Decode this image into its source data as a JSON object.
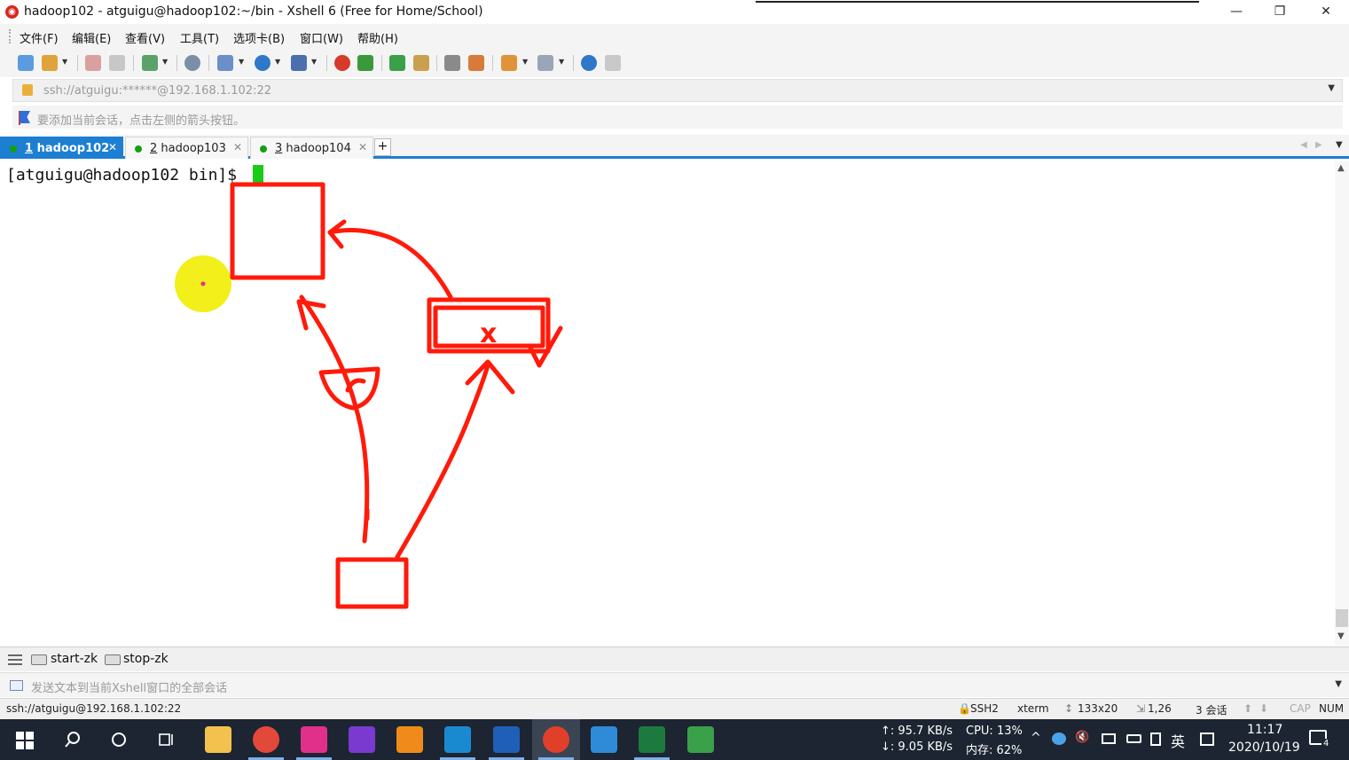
{
  "window": {
    "title": "hadoop102 - atguigu@hadoop102:~/bin - Xshell 6 (Free for Home/School)",
    "controls": {
      "minimize": "—",
      "restore": "❐",
      "close": "✕"
    }
  },
  "menu": [
    "文件(F)",
    "编辑(E)",
    "查看(V)",
    "工具(T)",
    "选项卡(B)",
    "窗口(W)",
    "帮助(H)"
  ],
  "address": {
    "value": "ssh://atguigu:******@192.168.1.102:22",
    "drop": "▼"
  },
  "hint": "要添加当前会话，点击左侧的箭头按钮。",
  "tabs": [
    {
      "num": "1",
      "label": "hadoop102",
      "close": "✕"
    },
    {
      "num": "2",
      "label": "hadoop103",
      "close": "✕"
    },
    {
      "num": "3",
      "label": "hadoop104",
      "close": "✕"
    }
  ],
  "tabbar": {
    "plus": "+",
    "prev": "◀",
    "next": "▶",
    "list": "▼"
  },
  "terminal": {
    "prompt": "[atguigu@hadoop102 bin]$ "
  },
  "quick_commands": [
    "start-zk",
    "stop-zk"
  ],
  "send_hint": "发送文本到当前Xshell窗口的全部会话",
  "status": {
    "connection": "ssh://atguigu@192.168.1.102:22",
    "protocol": "SSH2",
    "term": "xterm",
    "size": "133x20",
    "cursor": "1,26",
    "sessions": "3 会话",
    "cap": "CAP",
    "num": "NUM"
  },
  "taskbar": {
    "net_up": "↑: 95.7 KB/s",
    "net_down": "↓: 9.05 KB/s",
    "cpu": "CPU: 13%",
    "mem": "内存: 62%",
    "ime": "英",
    "time": "11:17",
    "date": "2020/10/19",
    "notifications": "4"
  },
  "annotation": {
    "mark": "x"
  },
  "colors": {
    "accent": "#1d7fd1",
    "session_dot": "#12a012",
    "cursor": "#19cc19",
    "ink": "#ff1a0a",
    "highlight": "#f2ef1a"
  }
}
